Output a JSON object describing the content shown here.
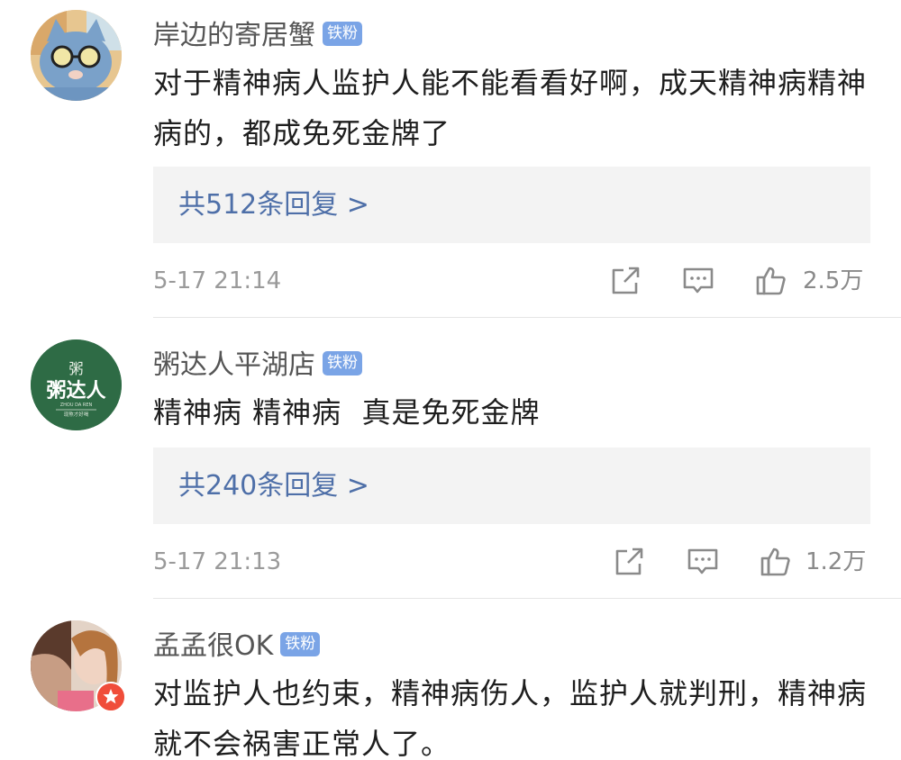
{
  "comments": [
    {
      "username": "岸边的寄居蟹",
      "badge": "铁粉",
      "text": "对于精神病人监护人能不能看看好啊，成天精神病精神病的，都成免死金牌了",
      "replies_label": "共512条回复 >",
      "time": "5-17 21:14",
      "likes": "2.5万",
      "avatar_icon": "cat-with-glasses-avatar"
    },
    {
      "username": "粥达人平湖店",
      "badge": "铁粉",
      "text": "精神病 精神病  真是免死金牌",
      "replies_label": "共240条回复 >",
      "time": "5-17 21:13",
      "likes": "1.2万",
      "avatar_icon": "shop-logo-avatar",
      "avatar_logo_text": "粥达人",
      "avatar_logo_sub": "ZHOU DA REN",
      "avatar_logo_mark": "粥",
      "avatar_logo_tagline": "现熬才好喝"
    },
    {
      "username": "孟孟很OK",
      "badge": "铁粉",
      "text": "对监护人也约束，精神病伤人，监护人就判刑，精神病就不会祸害正常人了。",
      "avatar_icon": "photo-avatar",
      "vip_icon": "star-badge-icon"
    }
  ],
  "icons": {
    "share": "share-icon",
    "comment": "comment-icon",
    "like": "thumbs-up-icon"
  },
  "colors": {
    "badge": "#7aa4e6",
    "reply_link": "#4e6fa8",
    "reply_bg": "#f3f3f3"
  }
}
